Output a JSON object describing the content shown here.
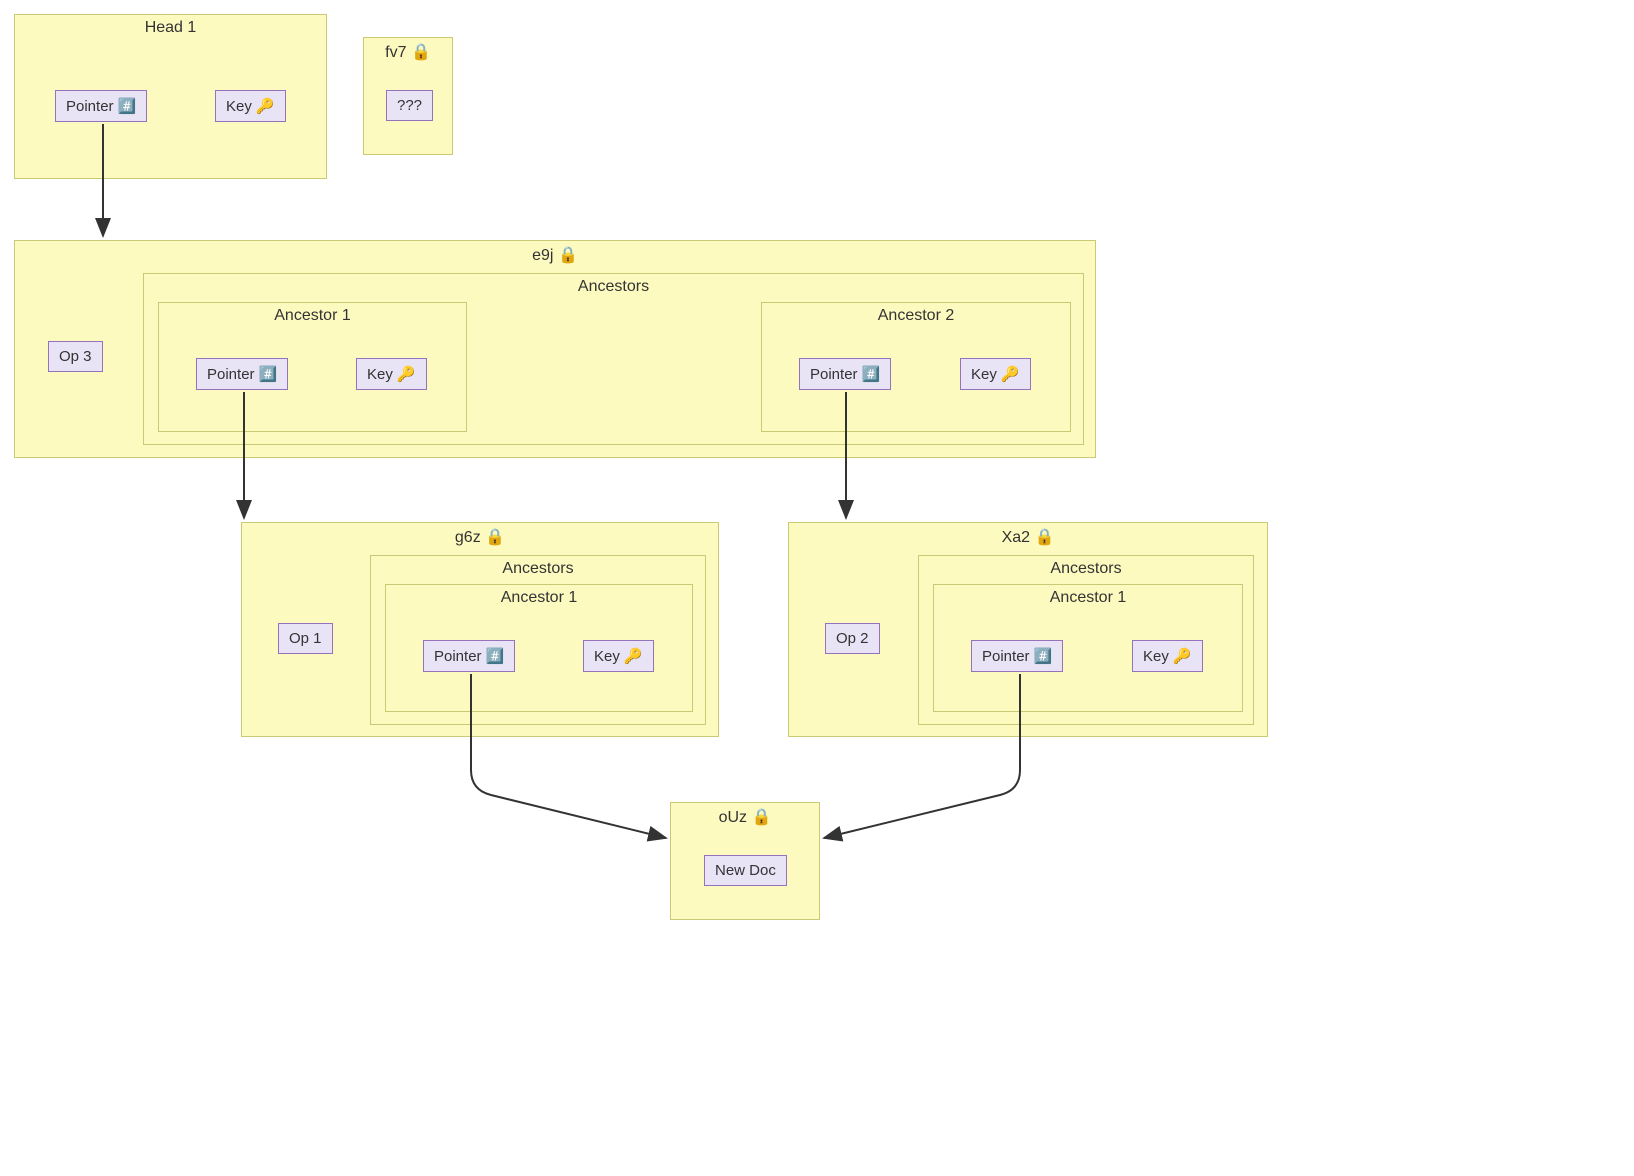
{
  "head1": {
    "title": "Head 1",
    "pointer": "Pointer",
    "key": "Key"
  },
  "fv7": {
    "title": "fv7",
    "content": "???"
  },
  "e9j": {
    "title": "e9j",
    "op": "Op 3",
    "ancestors_title": "Ancestors",
    "ancestor1": {
      "title": "Ancestor 1",
      "pointer": "Pointer",
      "key": "Key"
    },
    "ancestor2": {
      "title": "Ancestor 2",
      "pointer": "Pointer",
      "key": "Key"
    }
  },
  "g6z": {
    "title": "g6z",
    "op": "Op 1",
    "ancestors_title": "Ancestors",
    "ancestor1": {
      "title": "Ancestor 1",
      "pointer": "Pointer",
      "key": "Key"
    }
  },
  "xa2": {
    "title": "Xa2",
    "op": "Op 2",
    "ancestors_title": "Ancestors",
    "ancestor1": {
      "title": "Ancestor 1",
      "pointer": "Pointer",
      "key": "Key"
    }
  },
  "ouz": {
    "title": "oUz",
    "content": "New Doc"
  },
  "icons": {
    "hash": "#️⃣",
    "key": "🔑",
    "lock": "🔒"
  }
}
